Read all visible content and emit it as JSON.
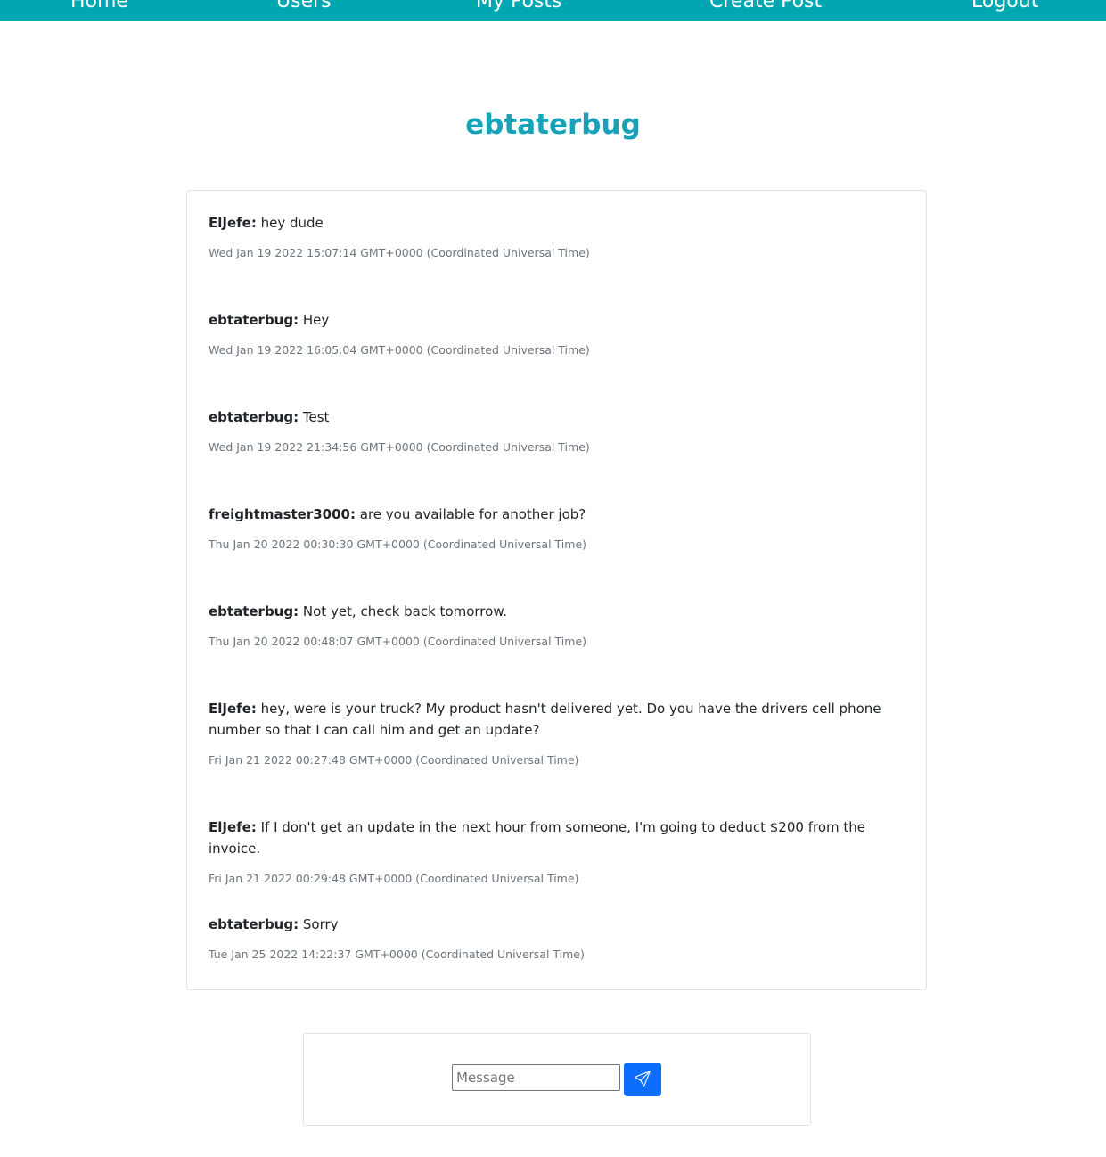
{
  "nav": {
    "items": [
      "Home",
      "Users",
      "My Posts",
      "Create Post",
      "Logout"
    ]
  },
  "page": {
    "title": "ebtaterbug"
  },
  "messages": [
    {
      "author": "ElJefe:",
      "text": "hey dude",
      "time": "Wed Jan 19 2022 15:07:14 GMT+0000 (Coordinated Universal Time)"
    },
    {
      "author": "ebtaterbug:",
      "text": "Hey",
      "time": "Wed Jan 19 2022 16:05:04 GMT+0000 (Coordinated Universal Time)"
    },
    {
      "author": "ebtaterbug:",
      "text": "Test",
      "time": "Wed Jan 19 2022 21:34:56 GMT+0000 (Coordinated Universal Time)"
    },
    {
      "author": "freightmaster3000:",
      "text": "are you available for another job?",
      "time": "Thu Jan 20 2022 00:30:30 GMT+0000 (Coordinated Universal Time)"
    },
    {
      "author": "ebtaterbug:",
      "text": "Not yet, check back tomorrow.",
      "time": "Thu Jan 20 2022 00:48:07 GMT+0000 (Coordinated Universal Time)"
    },
    {
      "author": "ElJefe:",
      "text": "hey, were is your truck? My product hasn't delivered yet. Do you have the drivers cell phone number so that I can call him and get an update?",
      "time": "Fri Jan 21 2022 00:27:48 GMT+0000 (Coordinated Universal Time)"
    },
    {
      "author": "ElJefe:",
      "text": "If I don't get an update in the next hour from someone, I'm going to deduct $200 from the invoice.",
      "time": "Fri Jan 21 2022 00:29:48 GMT+0000 (Coordinated Universal Time)"
    },
    {
      "author": "ebtaterbug:",
      "text": "Sorry",
      "time": "Tue Jan 25 2022 14:22:37 GMT+0000 (Coordinated Universal Time)"
    }
  ],
  "compose": {
    "placeholder": "Message",
    "value": "",
    "send_icon": "paper-plane-icon"
  },
  "colors": {
    "navbar": "#00a7b1",
    "title": "#17a2b8",
    "send_button": "#0d6efd"
  }
}
